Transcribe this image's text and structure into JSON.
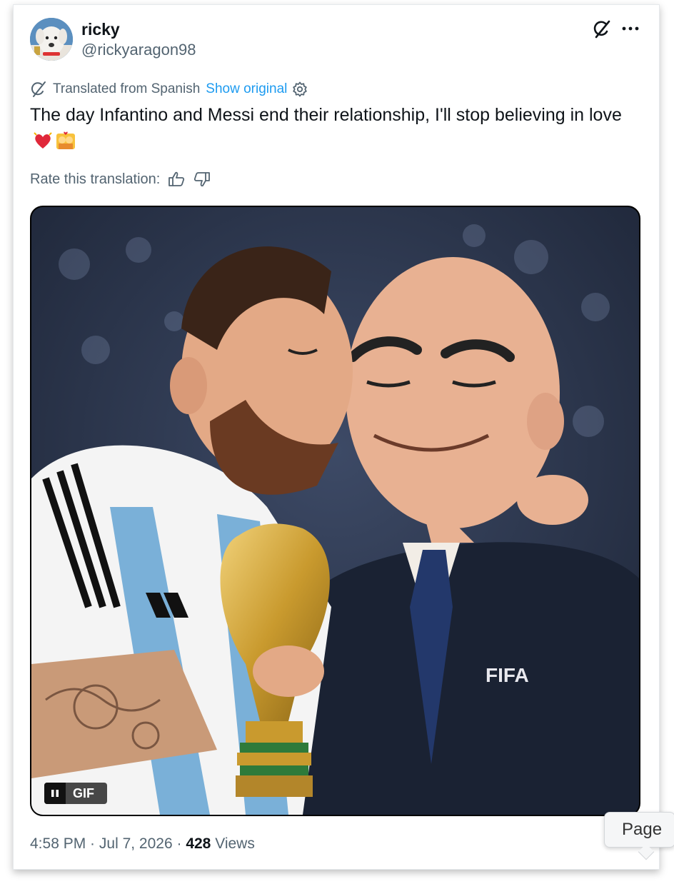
{
  "user": {
    "display_name": "ricky",
    "handle": "@rickyaragon98"
  },
  "translation": {
    "label": "Translated from Spanish",
    "show_original": "Show original"
  },
  "tweet": {
    "text": "The day Infantino and Messi end their relationship, I'll stop believing in love",
    "emojis": [
      "heart-with-ribbon",
      "kiss-couple"
    ]
  },
  "rating": {
    "label": "Rate this translation:"
  },
  "media": {
    "badge": "GIF",
    "jersey_text": "FIFA"
  },
  "meta": {
    "time": "4:58 PM",
    "separator1": " · ",
    "date": "Jul 7, 2026",
    "separator2": " · ",
    "views_count": "428",
    "views_label": " Views"
  },
  "tooltip": {
    "label": "Page"
  },
  "colors": {
    "link": "#1d9bf0",
    "secondary_text": "#536471",
    "primary_text": "#0f1419"
  }
}
